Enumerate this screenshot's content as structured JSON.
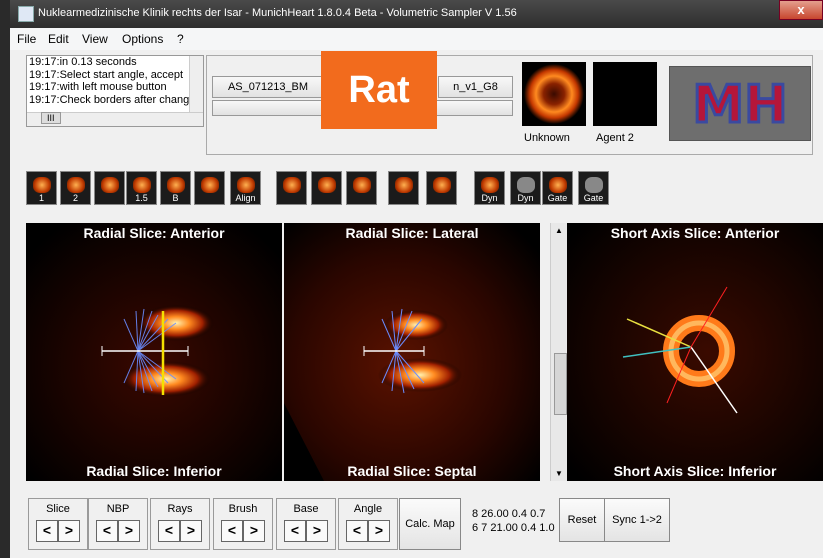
{
  "window": {
    "title": "Nuklearmedizinische Klinik rechts der Isar - MunichHeart 1.8.0.4 Beta - Volumetric Sampler V 1.56",
    "close": "x"
  },
  "menu": {
    "items": [
      "File",
      "Edit",
      "View",
      "Options",
      "?"
    ]
  },
  "log": {
    "lines": [
      "19:17:in  0.13 seconds",
      "19:17:Select start angle, accept",
      "19:17:with left mouse button",
      "19:17:Check borders after chang"
    ],
    "hscroll_thumb": "III"
  },
  "study": {
    "name_left": "AS_071213_BM",
    "name_right": "n_v1_G8",
    "overlay_label": "Rat"
  },
  "agents": {
    "agent1": "Unknown",
    "agent2": "Agent 2"
  },
  "logo": {
    "text": "MH"
  },
  "toolbar": [
    {
      "icon": "load-1-icon",
      "label": "1"
    },
    {
      "icon": "load-2-icon",
      "label": "2"
    },
    {
      "icon": "volume-box-icon",
      "label": ""
    },
    {
      "icon": "zoom-icon",
      "label": "1.5"
    },
    {
      "icon": "axis-icon",
      "label": "B"
    },
    {
      "icon": "heart-open-icon",
      "label": ""
    },
    {
      "icon": "align-icon",
      "label": "Align"
    },
    {
      "icon": "heart-arrow-icon",
      "label": ""
    },
    {
      "icon": "heart-view-icon",
      "label": ""
    },
    {
      "icon": "magnify-icon",
      "label": ""
    },
    {
      "icon": "grid-icon",
      "label": ""
    },
    {
      "icon": "monitor-icon",
      "label": ""
    },
    {
      "icon": "dyn-icon",
      "label": "Dyn"
    },
    {
      "icon": "dyn-disabled-icon",
      "label": "Dyn"
    },
    {
      "icon": "gate-icon",
      "label": "Gate"
    },
    {
      "icon": "gate-disabled-icon",
      "label": "Gate"
    }
  ],
  "views": {
    "v1": {
      "top": "Radial Slice: Anterior",
      "bottom": "Radial Slice: Inferior"
    },
    "v2": {
      "top": "Radial Slice: Lateral",
      "bottom": "Radial Slice: Septal"
    },
    "v3": {
      "top": "Short Axis Slice: Anterior",
      "bottom": "Short Axis Slice: Inferior"
    }
  },
  "controls": {
    "groups": [
      "Slice",
      "NBP",
      "Rays",
      "Brush",
      "Base",
      "Angle"
    ],
    "prev": "<",
    "next": ">",
    "calc_map": "Calc. Map",
    "readout_1": "8 26.00 0.4 0.7",
    "readout_2": "6 7 21.00 0.4 1.0",
    "reset": "Reset",
    "sync": "Sync 1->2"
  },
  "colors": {
    "overlay": "#f26b1d",
    "hot": "#ff7a1a"
  }
}
